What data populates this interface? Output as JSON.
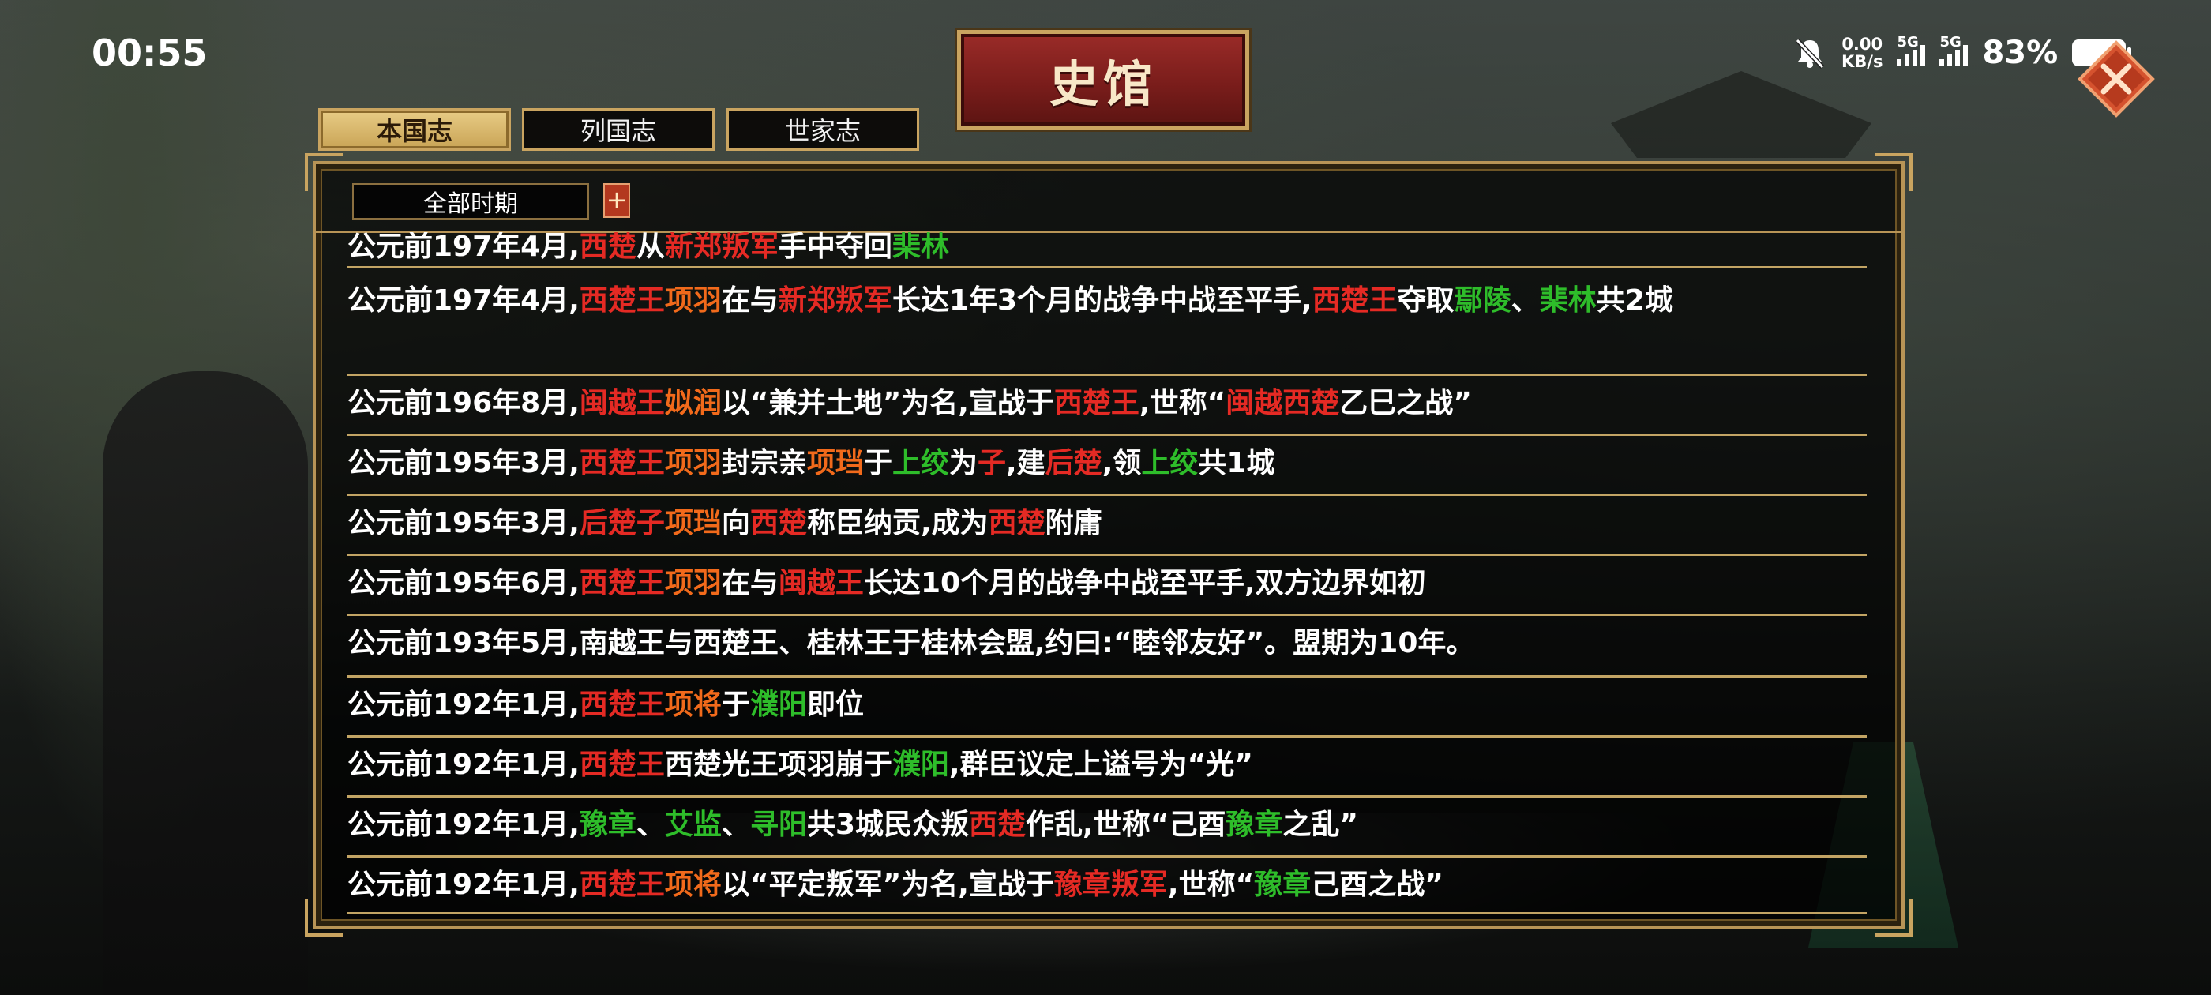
{
  "status_bar": {
    "time": "00:55",
    "net_speed_value": "0.00",
    "net_speed_unit": "KB/s",
    "signal1_label": "5G",
    "signal2_label": "5G",
    "battery": "83%"
  },
  "title": "史馆",
  "tabs": [
    {
      "label": "本国志",
      "active": true
    },
    {
      "label": "列国志",
      "active": false
    },
    {
      "label": "世家志",
      "active": false
    }
  ],
  "filter": {
    "period": "全部时期",
    "add_label": "+"
  },
  "entries": [
    {
      "segments": [
        [
          "公元前197年4月,",
          ""
        ],
        [
          "西楚",
          "red"
        ],
        [
          "从",
          ""
        ],
        [
          "新郑叛军",
          "red"
        ],
        [
          "手中夺回",
          ""
        ],
        [
          "棐林",
          "green"
        ]
      ]
    },
    {
      "segments": [
        [
          "公元前197年4月,",
          ""
        ],
        [
          "西楚王",
          "red"
        ],
        [
          "项羽",
          "orange"
        ],
        [
          "在与",
          ""
        ],
        [
          "新郑叛军",
          "red"
        ],
        [
          "长达1年3个月的战争中战至平手,",
          ""
        ],
        [
          "西楚王",
          "red"
        ],
        [
          "夺取",
          ""
        ],
        [
          "鄢陵",
          "green"
        ],
        [
          "、",
          ""
        ],
        [
          "棐林",
          "green"
        ],
        [
          "共2城",
          ""
        ]
      ]
    },
    {
      "segments": [
        [
          "公元前196年8月,",
          ""
        ],
        [
          "闽越王",
          "red"
        ],
        [
          "姒润",
          "orange"
        ],
        [
          "以“兼并土地”为名,宣战于",
          ""
        ],
        [
          "西楚王",
          "red"
        ],
        [
          ",世称“",
          ""
        ],
        [
          "闽越",
          "red"
        ],
        [
          "西楚",
          "red"
        ],
        [
          "乙巳之战”",
          ""
        ]
      ]
    },
    {
      "segments": [
        [
          "公元前195年3月,",
          ""
        ],
        [
          "西楚王",
          "red"
        ],
        [
          "项羽",
          "orange"
        ],
        [
          "封宗亲",
          ""
        ],
        [
          "项珰",
          "orange"
        ],
        [
          "于",
          ""
        ],
        [
          "上绞",
          "green"
        ],
        [
          "为",
          ""
        ],
        [
          "子",
          "red"
        ],
        [
          ",建",
          ""
        ],
        [
          "后楚",
          "red"
        ],
        [
          ",领",
          ""
        ],
        [
          "上绞",
          "green"
        ],
        [
          "共1城",
          ""
        ]
      ]
    },
    {
      "segments": [
        [
          "公元前195年3月,",
          ""
        ],
        [
          "后楚子",
          "red"
        ],
        [
          "项珰",
          "orange"
        ],
        [
          "向",
          ""
        ],
        [
          "西楚",
          "red"
        ],
        [
          "称臣纳贡,成为",
          ""
        ],
        [
          "西楚",
          "red"
        ],
        [
          "附庸",
          ""
        ]
      ]
    },
    {
      "segments": [
        [
          "公元前195年6月,",
          ""
        ],
        [
          "西楚王",
          "red"
        ],
        [
          "项羽",
          "orange"
        ],
        [
          "在与",
          ""
        ],
        [
          "闽越王",
          "red"
        ],
        [
          "长达10个月的战争中战至平手,双方边界如初",
          ""
        ]
      ]
    },
    {
      "segments": [
        [
          "公元前193年5月,南越王与西楚王、桂林王于桂林会盟,约曰:“睦邻友好”。盟期为10年。",
          ""
        ]
      ]
    },
    {
      "segments": [
        [
          "公元前192年1月,",
          ""
        ],
        [
          "西楚王",
          "red"
        ],
        [
          "项将",
          "orange"
        ],
        [
          "于",
          ""
        ],
        [
          "濮阳",
          "green"
        ],
        [
          "即位",
          ""
        ]
      ]
    },
    {
      "segments": [
        [
          "公元前192年1月,",
          ""
        ],
        [
          "西楚王",
          "red"
        ],
        [
          "西楚光王项羽崩于",
          ""
        ],
        [
          "濮阳",
          "green"
        ],
        [
          ",群臣议定上谥号为“光”",
          ""
        ]
      ]
    },
    {
      "segments": [
        [
          "公元前192年1月,",
          ""
        ],
        [
          "豫章",
          "green"
        ],
        [
          "、",
          ""
        ],
        [
          "艾监",
          "green"
        ],
        [
          "、",
          ""
        ],
        [
          "寻阳",
          "green"
        ],
        [
          "共3城民众叛",
          ""
        ],
        [
          "西楚",
          "red"
        ],
        [
          "作乱,世称“己酉",
          ""
        ],
        [
          "豫章",
          "green"
        ],
        [
          "之乱”",
          ""
        ]
      ]
    },
    {
      "segments": [
        [
          "公元前192年1月,",
          ""
        ],
        [
          "西楚王",
          "red"
        ],
        [
          "项将",
          "orange"
        ],
        [
          "以“平定叛军”为名,宣战于",
          ""
        ],
        [
          "豫章叛军",
          "red"
        ],
        [
          ",世称“",
          ""
        ],
        [
          "豫章",
          "green"
        ],
        [
          "己酉之战”",
          ""
        ]
      ]
    }
  ],
  "colors": {
    "gold": "#c9a460",
    "banner_red": "#7a1d1b",
    "state_red": "#e52a24",
    "place_green": "#2ebd2a",
    "person_orange": "#f26a1b"
  }
}
